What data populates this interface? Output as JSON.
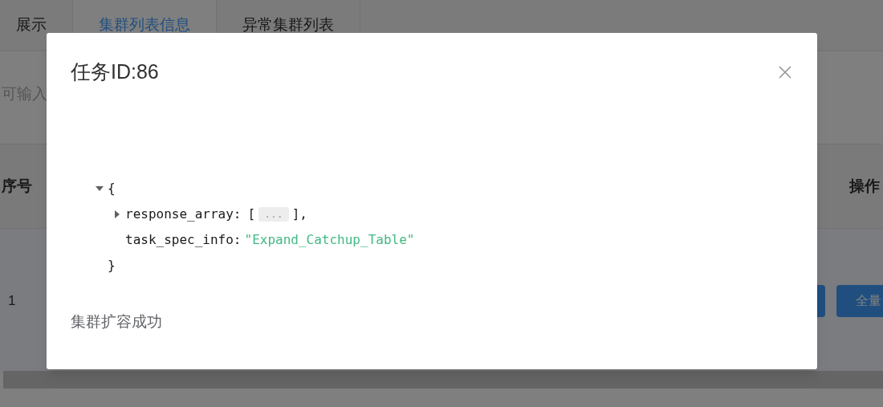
{
  "page": {
    "tabs": [
      {
        "label": "展示",
        "selected": false
      },
      {
        "label": "集群列表信息",
        "selected": true
      },
      {
        "label": "异常集群列表",
        "selected": false
      }
    ],
    "search": {
      "placeholder": "可输入"
    },
    "table": {
      "columns": [
        "序号",
        "操作"
      ],
      "rows": [
        {
          "index": "1",
          "action": "全量"
        }
      ]
    }
  },
  "modal": {
    "title": "任务ID:86",
    "json_view": {
      "expanded": true,
      "open": "{",
      "close": "}",
      "entries": [
        {
          "kind": "collapsed",
          "expanded": false,
          "key": "response_array:",
          "open": "[",
          "placeholder": "...",
          "close": "],"
        },
        {
          "kind": "string",
          "key": "task_spec_info:",
          "value": "\"Expand_Catchup_Table\""
        }
      ]
    },
    "message": "集群扩容成功"
  }
}
